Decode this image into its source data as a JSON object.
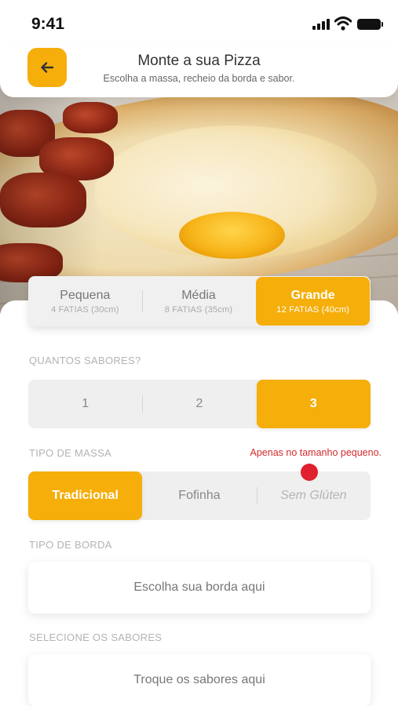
{
  "status_bar": {
    "time": "9:41",
    "icons": [
      "signal-icon",
      "wifi-icon",
      "battery-icon"
    ]
  },
  "header": {
    "back_icon": "arrow-left-icon",
    "title": "Monte a sua Pizza",
    "subtitle": "Escolha a massa, recheio da borda e sabor."
  },
  "sizes": [
    {
      "label": "Pequena",
      "sub": "4 FATIAS (30cm)",
      "selected": false
    },
    {
      "label": "Média",
      "sub": "8 FATIAS (35cm)",
      "selected": false
    },
    {
      "label": "Grande",
      "sub": "12 FATIAS (40cm)",
      "selected": true
    }
  ],
  "flavors_count": {
    "label": "QUANTOS SABORES?",
    "options": [
      {
        "label": "1",
        "selected": false
      },
      {
        "label": "2",
        "selected": false
      },
      {
        "label": "3",
        "selected": true
      }
    ]
  },
  "massa": {
    "label": "TIPO DE MASSA",
    "warning": "Apenas no tamanho pequeno.",
    "options": [
      {
        "label": "Tradicional",
        "selected": true
      },
      {
        "label": "Fofinha",
        "selected": false
      },
      {
        "label": "Sem Glúten",
        "selected": false,
        "disabled": true
      }
    ]
  },
  "borda": {
    "label": "TIPO DE BORDA",
    "placeholder": "Escolha sua borda aqui"
  },
  "sabores": {
    "label": "SELECIONE OS SABORES",
    "placeholder": "Troque os sabores aqui"
  },
  "colors": {
    "accent": "#f5ae0a",
    "warning": "#d22b2b",
    "control_bg": "#efefef"
  }
}
